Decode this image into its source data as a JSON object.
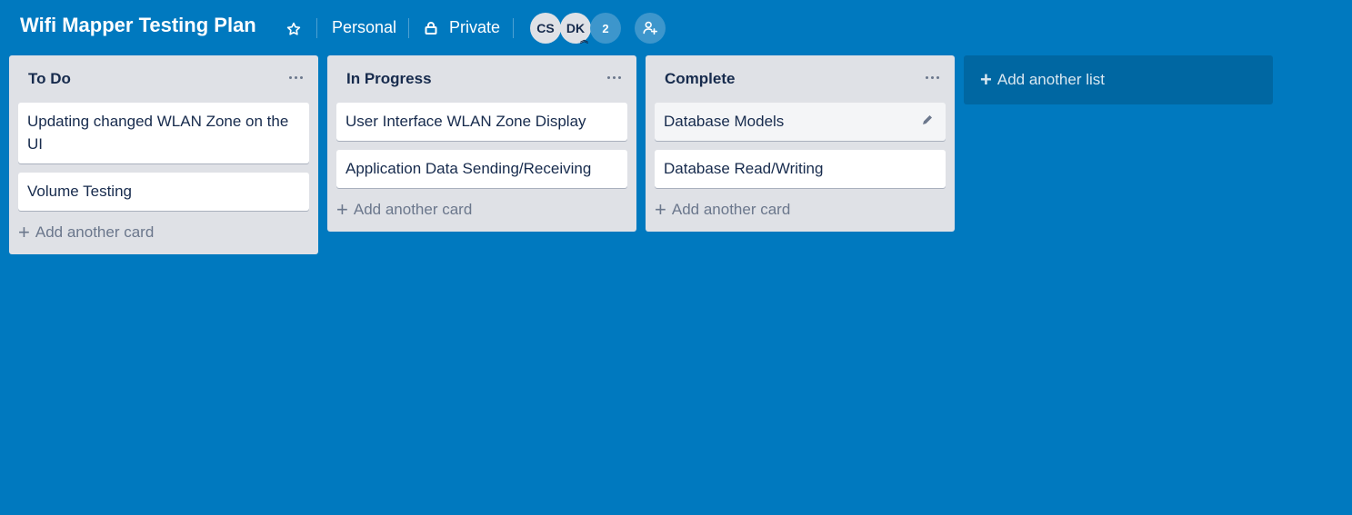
{
  "board": {
    "title": "Wifi Mapper Testing Plan",
    "team": "Personal",
    "visibility": "Private",
    "members": [
      "CS",
      "DK"
    ],
    "extra_member_count": "2",
    "background_color": "#0079bf"
  },
  "lists": [
    {
      "title": "To Do",
      "cards": [
        "Updating changed WLAN Zone on the UI",
        "Volume Testing"
      ],
      "add_card_label": "Add another card"
    },
    {
      "title": "In Progress",
      "cards": [
        "User Interface WLAN Zone Display",
        "Application Data Sending/Receiving"
      ],
      "add_card_label": "Add another card"
    },
    {
      "title": "Complete",
      "cards": [
        "Database Models",
        "Database Read/Writing"
      ],
      "add_card_label": "Add another card"
    }
  ],
  "add_list_label": "Add another list",
  "icons": {
    "star": "star-icon",
    "lock": "lock-icon",
    "invite": "add-member-icon",
    "menu": "ellipsis-icon",
    "edit": "pencil-icon",
    "plus": "plus-icon"
  }
}
